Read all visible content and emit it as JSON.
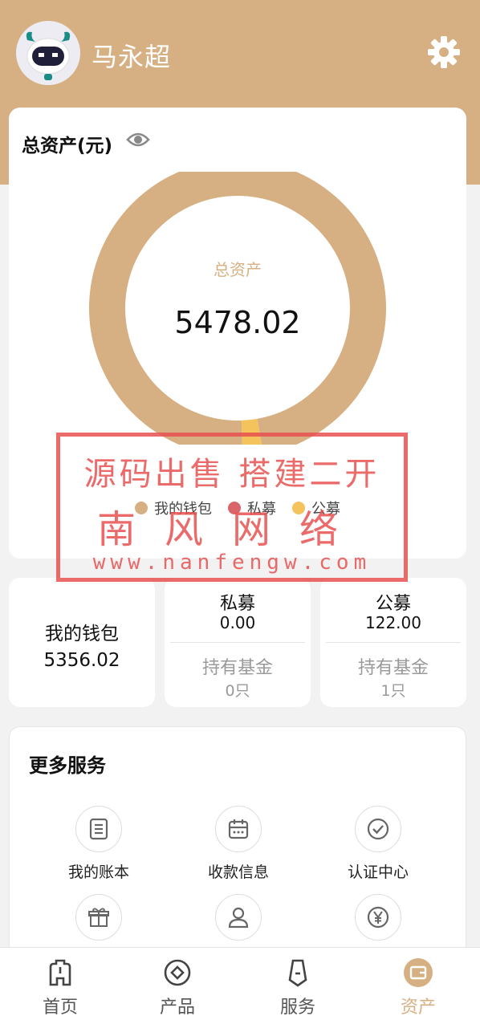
{
  "header": {
    "username": "马永超",
    "avatar_icon": "robot-avatar-icon",
    "settings_icon": "gear-icon",
    "background_color": "#d6b082"
  },
  "total_assets": {
    "title": "总资产(元)",
    "visibility_icon": "eye-icon",
    "center_label": "总资产",
    "center_value": "5478.02"
  },
  "chart_data": {
    "type": "pie",
    "title": "",
    "categories": [
      "我的钱包",
      "私募",
      "公募"
    ],
    "values": [
      5356.02,
      0.0,
      122.0
    ],
    "colors": [
      "#d6b082",
      "#d9656a",
      "#f4c35c"
    ],
    "legend_position": "bottom"
  },
  "watermark": {
    "line1": "源码出售 搭建二开",
    "line2": "南风网络",
    "line3": "www.nanfengw.com"
  },
  "wallet": {
    "title": "我的钱包",
    "value": "5356.02"
  },
  "private_fund": {
    "title": "私募",
    "value": "0.00",
    "hold_label": "持有基金",
    "hold_count": "0只"
  },
  "public_fund": {
    "title": "公募",
    "value": "122.00",
    "hold_label": "持有基金",
    "hold_count": "1只"
  },
  "services": {
    "title": "更多服务",
    "items": [
      {
        "label": "我的账本",
        "icon": "ledger-icon"
      },
      {
        "label": "收款信息",
        "icon": "calendar-icon"
      },
      {
        "label": "认证中心",
        "icon": "check-circle-icon"
      },
      {
        "label": "",
        "icon": "gift-icon"
      },
      {
        "label": "",
        "icon": "user-icon"
      },
      {
        "label": "",
        "icon": "yen-icon"
      }
    ]
  },
  "tabbar": {
    "items": [
      {
        "label": "首页",
        "icon": "home-icon",
        "active": false
      },
      {
        "label": "产品",
        "icon": "product-icon",
        "active": false
      },
      {
        "label": "服务",
        "icon": "service-icon",
        "active": false
      },
      {
        "label": "资产",
        "icon": "wallet-icon",
        "active": true
      }
    ],
    "active_color": "#d6b082"
  }
}
